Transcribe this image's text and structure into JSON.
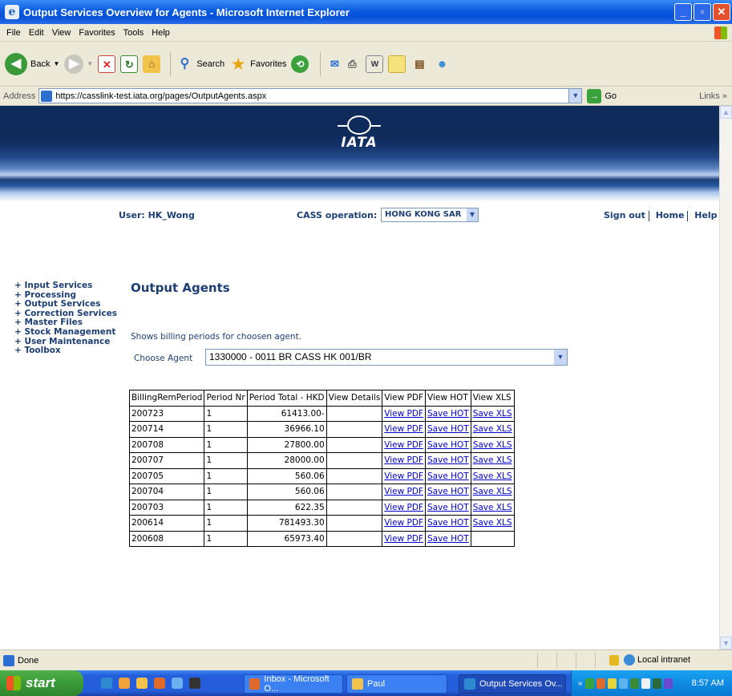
{
  "window": {
    "title": "Output Services Overview for Agents - Microsoft Internet Explorer"
  },
  "menu": [
    "File",
    "Edit",
    "View",
    "Favorites",
    "Tools",
    "Help"
  ],
  "toolbar": {
    "back": "Back",
    "search": "Search",
    "favorites": "Favorites"
  },
  "address": {
    "label": "Address",
    "url": "https://casslink-test.iata.org/pages/OutputAgents.aspx",
    "go": "Go",
    "links": "Links"
  },
  "banner": {
    "logo_text": "IATA"
  },
  "header": {
    "user": "User: HK_Wong",
    "cass_label": "CASS operation:",
    "cass_value": "HONG KONG SAR",
    "sign_out": "Sign out",
    "home": "Home",
    "help": "Help"
  },
  "sidenav": [
    "+ Input Services",
    "+ Processing",
    "+ Output Services",
    "+ Correction Services",
    "+ Master Files",
    "+ Stock Management",
    "+ User Maintenance",
    "+ Toolbox"
  ],
  "main": {
    "title": "Output Agents",
    "description": "Shows billing periods for choosen agent.",
    "choose_label": "Choose Agent",
    "agent_value": "1330000 - 0011 BR CASS HK 001/BR"
  },
  "table": {
    "headers": [
      "BillingRemPeriod",
      "Period Nr",
      "Period Total - HKD",
      "View Details",
      "View PDF",
      "View HOT",
      "View XLS"
    ],
    "rows": [
      {
        "period": "200723",
        "nr": "1",
        "total": "61413.00-",
        "details": "",
        "pdf": "View PDF",
        "hot": "Save HOT",
        "xls": "Save XLS"
      },
      {
        "period": "200714",
        "nr": "1",
        "total": "36966.10",
        "details": "",
        "pdf": "View PDF",
        "hot": "Save HOT",
        "xls": "Save XLS"
      },
      {
        "period": "200708",
        "nr": "1",
        "total": "27800.00",
        "details": "",
        "pdf": "View PDF",
        "hot": "Save HOT",
        "xls": "Save XLS"
      },
      {
        "period": "200707",
        "nr": "1",
        "total": "28000.00",
        "details": "",
        "pdf": "View PDF",
        "hot": "Save HOT",
        "xls": "Save XLS"
      },
      {
        "period": "200705",
        "nr": "1",
        "total": "560.06",
        "details": "",
        "pdf": "View PDF",
        "hot": "Save HOT",
        "xls": "Save XLS"
      },
      {
        "period": "200704",
        "nr": "1",
        "total": "560.06",
        "details": "",
        "pdf": "View PDF",
        "hot": "Save HOT",
        "xls": "Save XLS"
      },
      {
        "period": "200703",
        "nr": "1",
        "total": "622.35",
        "details": "",
        "pdf": "View PDF",
        "hot": "Save HOT",
        "xls": "Save XLS"
      },
      {
        "period": "200614",
        "nr": "1",
        "total": "781493.30",
        "details": "",
        "pdf": "View PDF",
        "hot": "Save HOT",
        "xls": "Save XLS"
      },
      {
        "period": "200608",
        "nr": "1",
        "total": "65973.40",
        "details": "",
        "pdf": "View PDF",
        "hot": "Save HOT",
        "xls": ""
      }
    ]
  },
  "status": {
    "text": "Done",
    "zone": "Local intranet"
  },
  "taskbar": {
    "start": "start",
    "tasks": [
      "Inbox - Microsoft O...",
      "Paul",
      "Output Services Ov..."
    ],
    "clock": "8:57 AM"
  },
  "colors": {
    "brand_navy": "#0f2b5c",
    "link": "#0000cc",
    "heading": "#1d3f73"
  }
}
